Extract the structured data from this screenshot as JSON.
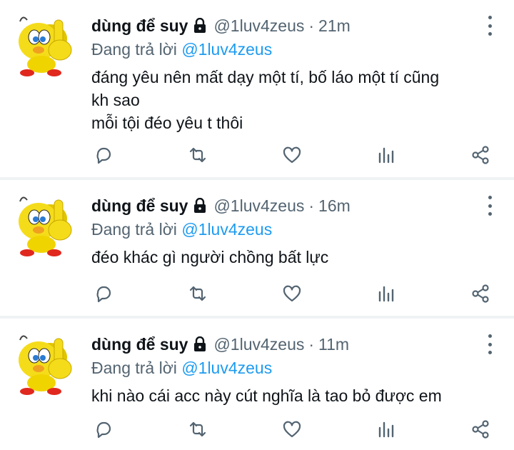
{
  "tweets": [
    {
      "author_name": "dùng để suy",
      "handle": "@1luv4zeus",
      "separator": "·",
      "time": "21m",
      "replying_prefix": "Đang trả lời",
      "replying_to": "@1luv4zeus",
      "lines": [
        "đáng yêu nên mất dạy một tí, bố láo một tí cũng",
        "kh sao",
        "mỗi tội đéo yêu t thôi"
      ]
    },
    {
      "author_name": "dùng để suy",
      "handle": "@1luv4zeus",
      "separator": "·",
      "time": "16m",
      "replying_prefix": "Đang trả lời",
      "replying_to": "@1luv4zeus",
      "lines": [
        "đéo khác gì người chồng bất lực"
      ]
    },
    {
      "author_name": "dùng để suy",
      "handle": "@1luv4zeus",
      "separator": "·",
      "time": "11m",
      "replying_prefix": "Đang trả lời",
      "replying_to": "@1luv4zeus",
      "lines": [
        "khi nào cái acc này cút nghĩa là tao bỏ được em"
      ]
    }
  ],
  "icons": {
    "avatar": "tweety-bird-avatar",
    "lock": "lock-icon",
    "more": "more-vertical-icon",
    "reply": "reply-icon",
    "retweet": "retweet-icon",
    "like": "heart-icon",
    "views": "views-icon",
    "share": "share-icon"
  },
  "colors": {
    "text": "#0f1419",
    "secondary": "#536471",
    "accent": "#1d9bf0",
    "divider": "#eff3f4"
  }
}
